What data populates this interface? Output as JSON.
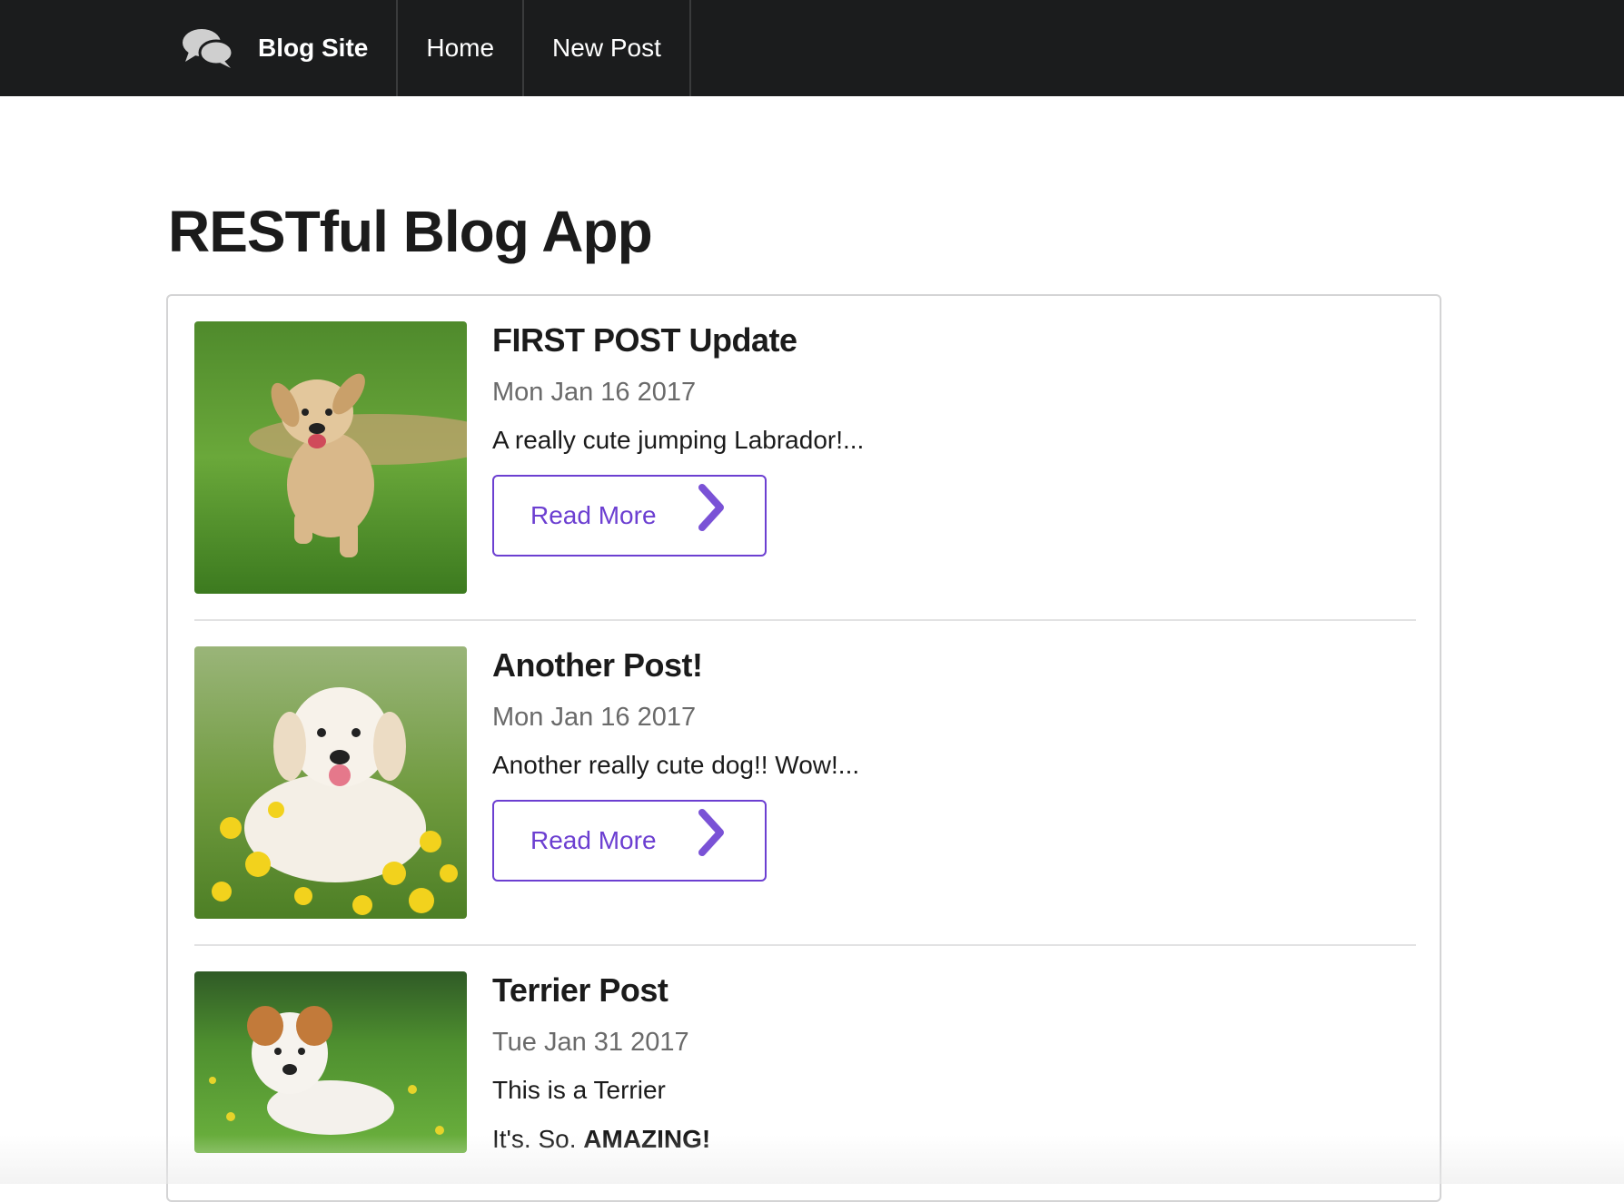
{
  "navbar": {
    "brand_icon": "comments-icon",
    "brand_label": "Blog Site",
    "items": [
      {
        "label": "Home"
      },
      {
        "label": "New Post"
      }
    ]
  },
  "page_title": "RESTful Blog App",
  "colors": {
    "navbar": "#1b1c1d",
    "accent": "#6c3fd1"
  },
  "posts": [
    {
      "title": "FIRST POST Update",
      "date": "Mon Jan 16 2017",
      "excerpt": "A really cute jumping Labrador!...",
      "button_label": "Read More",
      "image": "golden-puppy-running"
    },
    {
      "title": "Another Post!",
      "date": "Mon Jan 16 2017",
      "excerpt": "Another really cute dog!! Wow!...",
      "button_label": "Read More",
      "image": "golden-retriever-in-flowers"
    },
    {
      "title": "Terrier Post",
      "date": "Tue Jan 31 2017",
      "excerpt": "This is a Terrier",
      "extra_prefix": "It's. So. ",
      "extra_bold": "AMAZING!",
      "image": "jack-russell-terrier-on-grass"
    }
  ]
}
